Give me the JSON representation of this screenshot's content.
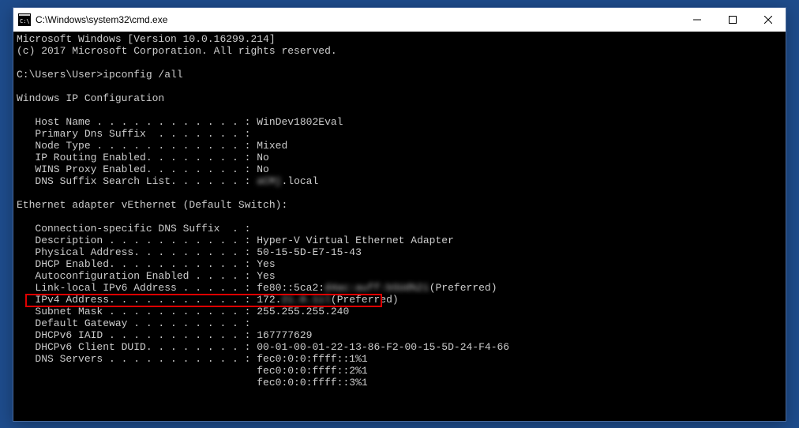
{
  "titlebar": {
    "title": "C:\\Windows\\system32\\cmd.exe"
  },
  "terminal": {
    "version_line": "Microsoft Windows [Version 10.0.16299.214]",
    "copyright_line": "(c) 2017 Microsoft Corporation. All rights reserved.",
    "prompt": "C:\\Users\\User>",
    "command": "ipconfig /all",
    "heading": "Windows IP Configuration",
    "host": {
      "host_name_label": "   Host Name . . . . . . . . . . . . : ",
      "host_name_value": "WinDev1802Eval",
      "primary_dns_label": "   Primary Dns Suffix  . . . . . . . :",
      "node_type_label": "   Node Type . . . . . . . . . . . . : ",
      "node_type_value": "Mixed",
      "ip_routing_label": "   IP Routing Enabled. . . . . . . . : ",
      "ip_routing_value": "No",
      "wins_proxy_label": "   WINS Proxy Enabled. . . . . . . . : ",
      "wins_proxy_value": "No",
      "dns_suffix_label": "   DNS Suffix Search List. . . . . . : ",
      "dns_suffix_blur": "aCMj",
      "dns_suffix_value": ".local"
    },
    "adapter_heading": "Ethernet adapter vEthernet (Default Switch):",
    "adapter": {
      "conn_suffix_label": "   Connection-specific DNS Suffix  . :",
      "description_label": "   Description . . . . . . . . . . . : ",
      "description_value": "Hyper-V Virtual Ethernet Adapter",
      "physical_label": "   Physical Address. . . . . . . . . : ",
      "physical_value": "50-15-5D-E7-15-43",
      "dhcp_label": "   DHCP Enabled. . . . . . . . . . . : ",
      "dhcp_value": "Yes",
      "autoconfig_label": "   Autoconfiguration Enabled . . . . : ",
      "autoconfig_value": "Yes",
      "ipv6_label": "   Link-local IPv6 Address . . . . . : ",
      "ipv6_prefix": "fe80::5ca2:",
      "ipv6_blur": "d4ac:auff:bSUd%2i",
      "ipv6_suffix": "(Preferred)",
      "ipv4_label": "   IPv4 Address. . . . . . . . . . . : ",
      "ipv4_prefix": "172.",
      "ipv4_blur": "2i.0.1il",
      "ipv4_suffix": "(Preferred)",
      "subnet_label": "   Subnet Mask . . . . . . . . . . . : ",
      "subnet_value": "255.255.255.240",
      "gateway_label": "   Default Gateway . . . . . . . . . :",
      "iaid_label": "   DHCPv6 IAID . . . . . . . . . . . : ",
      "iaid_value": "167777629",
      "duid_label": "   DHCPv6 Client DUID. . . . . . . . : ",
      "duid_value": "00-01-00-01-22-13-86-F2-00-15-5D-24-F4-66",
      "dns_servers_label": "   DNS Servers . . . . . . . . . . . : ",
      "dns1": "fec0:0:0:ffff::1%1",
      "dns2_pad": "                                       ",
      "dns2": "fec0:0:0:ffff::2%1",
      "dns3_pad": "                                       ",
      "dns3": "fec0:0:0:ffff::3%1"
    }
  }
}
